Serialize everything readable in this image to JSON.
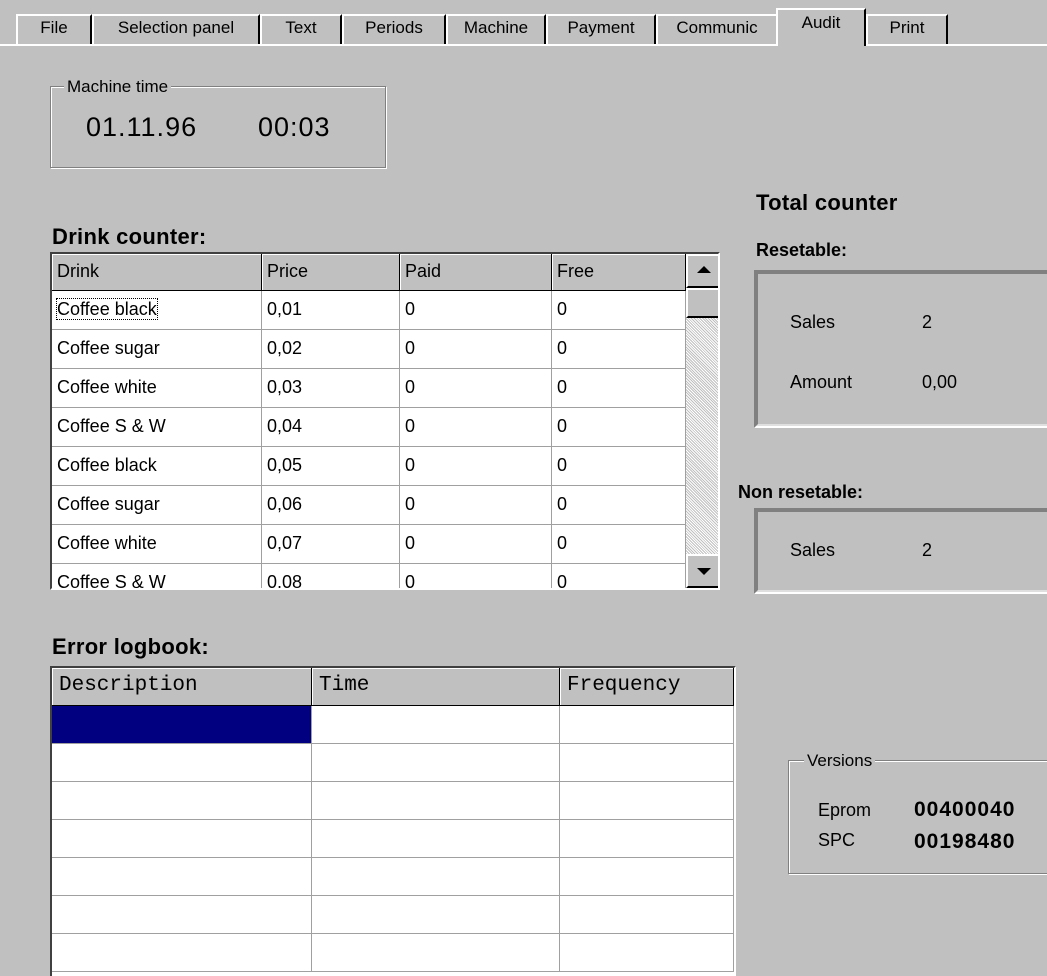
{
  "tabs": [
    {
      "label": "File",
      "active": false
    },
    {
      "label": "Selection panel",
      "active": false
    },
    {
      "label": "Text",
      "active": false
    },
    {
      "label": "Periods",
      "active": false
    },
    {
      "label": "Machine",
      "active": false
    },
    {
      "label": "Payment",
      "active": false
    },
    {
      "label": "Communic",
      "active": false
    },
    {
      "label": "Audit",
      "active": true
    },
    {
      "label": "Print",
      "active": false
    }
  ],
  "machine_time": {
    "label": "Machine time",
    "date": "01.11.96",
    "time": "00:03"
  },
  "drink_counter": {
    "title": "Drink counter:",
    "columns": [
      "Drink",
      "Price",
      "Paid",
      "Free"
    ],
    "rows": [
      [
        "Coffee black",
        "0,01",
        "0",
        "0"
      ],
      [
        "Coffee sugar",
        "0,02",
        "0",
        "0"
      ],
      [
        "Coffee white",
        "0,03",
        "0",
        "0"
      ],
      [
        "Coffee S & W",
        "0,04",
        "0",
        "0"
      ],
      [
        "Coffee black",
        "0,05",
        "0",
        "0"
      ],
      [
        "Coffee sugar",
        "0,06",
        "0",
        "0"
      ],
      [
        "Coffee white",
        "0,07",
        "0",
        "0"
      ],
      [
        "Coffee S & W",
        "0,08",
        "0",
        "0"
      ]
    ]
  },
  "total_counter": {
    "title": "Total counter",
    "resetable": {
      "label": "Resetable:",
      "sales_label": "Sales",
      "sales_value": "2",
      "amount_label": "Amount",
      "amount_value": "0,00"
    },
    "non_resetable": {
      "label": "Non resetable:",
      "sales_label": "Sales",
      "sales_value": "2"
    }
  },
  "error_logbook": {
    "title": "Error logbook:",
    "columns": [
      "Description",
      "Time",
      "Frequency"
    ]
  },
  "versions": {
    "label": "Versions",
    "eprom_label": "Eprom",
    "eprom_value": "00400040",
    "spc_label": "SPC",
    "spc_value": "00198480"
  },
  "colors": {
    "background": "#c0c0c0",
    "selection": "#000080",
    "grid_bg": "#ffffff"
  }
}
